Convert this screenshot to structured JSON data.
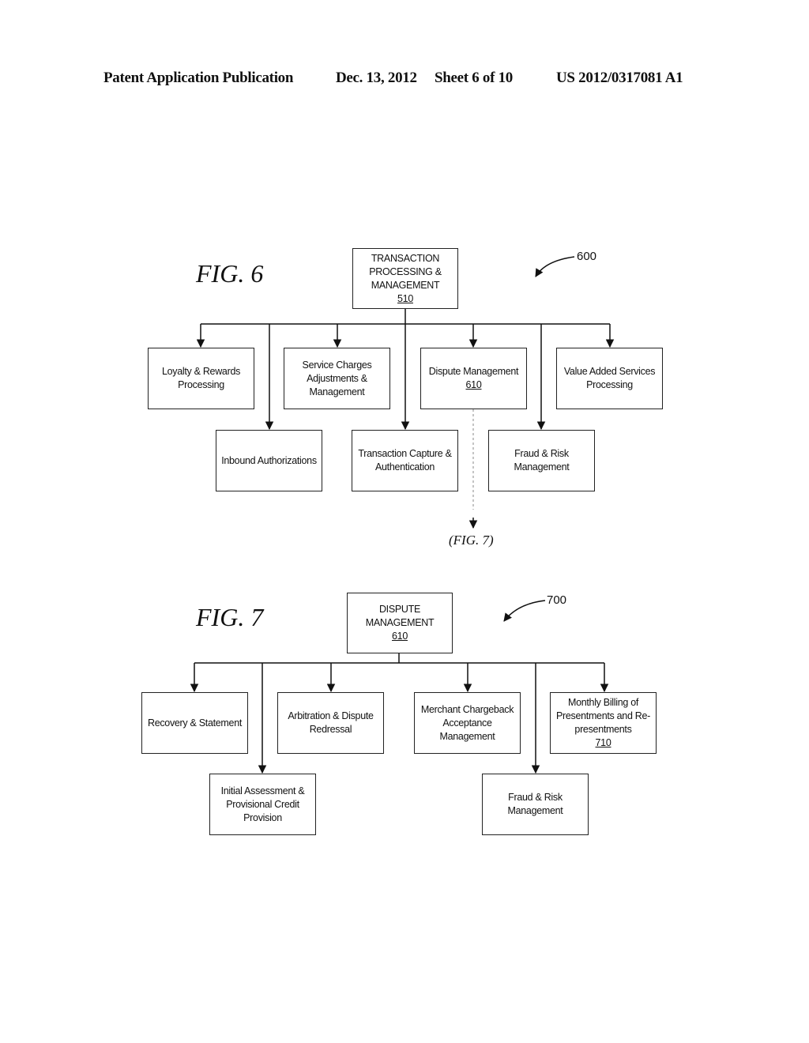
{
  "header": {
    "publication": "Patent Application Publication",
    "date": "Dec. 13, 2012",
    "sheet": "Sheet 6 of 10",
    "number": "US 2012/0317081 A1"
  },
  "fig6": {
    "label": "FIG. 6",
    "ref": "600",
    "root": {
      "lines": [
        "TRANSACTION",
        "PROCESSING &",
        "MANAGEMENT"
      ],
      "ref": "510"
    },
    "children": [
      {
        "lines": [
          "Loyalty & Rewards",
          "Processing"
        ]
      },
      {
        "lines": [
          "Inbound Authorizations"
        ]
      },
      {
        "lines": [
          "Service Charges",
          "Adjustments &",
          "Management"
        ]
      },
      {
        "lines": [
          "Transaction Capture &",
          "Authentication"
        ]
      },
      {
        "lines": [
          "Dispute Management"
        ],
        "ref": "610"
      },
      {
        "lines": [
          "Fraud & Risk",
          "Management"
        ]
      },
      {
        "lines": [
          "Value Added Services",
          "Processing"
        ]
      }
    ],
    "continuation": "(FIG. 7)"
  },
  "fig7": {
    "label": "FIG. 7",
    "ref": "700",
    "root": {
      "lines": [
        "DISPUTE",
        "MANAGEMENT"
      ],
      "ref": "610"
    },
    "children": [
      {
        "lines": [
          "Recovery & Statement"
        ]
      },
      {
        "lines": [
          "Initial Assessment &",
          "Provisional Credit",
          "Provision"
        ]
      },
      {
        "lines": [
          "Arbitration & Dispute",
          "Redressal"
        ]
      },
      {
        "lines": [
          "Merchant Chargeback",
          "Acceptance",
          "Management"
        ]
      },
      {
        "lines": [
          "Fraud & Risk",
          "Management"
        ]
      },
      {
        "lines": [
          "Monthly Billing of",
          "Presentments and Re-",
          "presentments"
        ],
        "ref": "710"
      }
    ]
  }
}
